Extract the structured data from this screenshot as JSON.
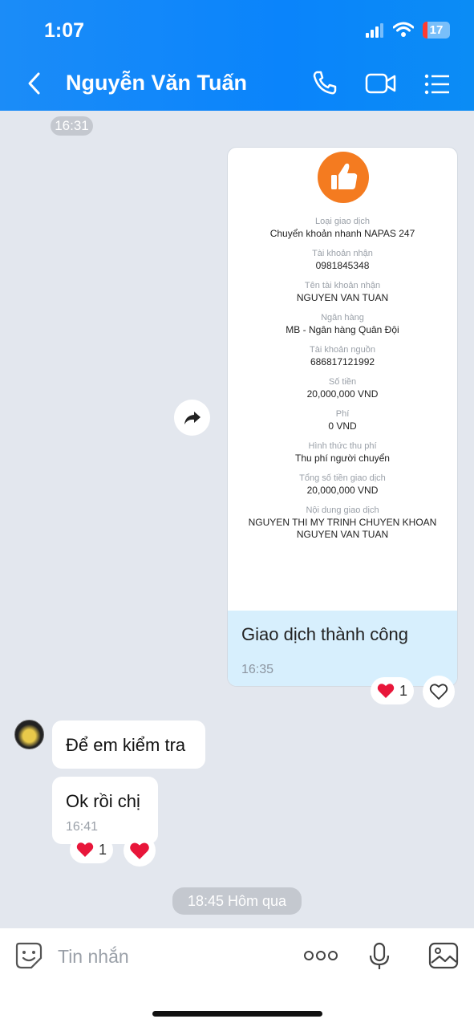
{
  "status_bar": {
    "time": "1:07",
    "battery": "17",
    "battery_level": 0.17
  },
  "header": {
    "contact_name": "Nguyễn Văn Tuấn",
    "icons": [
      "back-chevron-icon",
      "phone-icon",
      "video-call-icon",
      "menu-list-icon"
    ]
  },
  "chat": {
    "time_divider_1": "16:31",
    "transfer_card": {
      "fields": [
        {
          "label": "Loại giao dịch",
          "value": "Chuyển khoản nhanh NAPAS 247"
        },
        {
          "label": "Tài khoản nhận",
          "value": "0981845348"
        },
        {
          "label": "Tên tài khoản nhận",
          "value": "NGUYEN VAN TUAN"
        },
        {
          "label": "Ngân hàng",
          "value": "MB - Ngân hàng Quân Đội"
        },
        {
          "label": "Tài khoản nguồn",
          "value": "686817121992"
        },
        {
          "label": "Số tiền",
          "value": "20,000,000 VND"
        },
        {
          "label": "Phí",
          "value": "0 VND"
        },
        {
          "label": "Hình thức thu phí",
          "value": "Thu phí người chuyển"
        },
        {
          "label": "Tổng số tiền giao dịch",
          "value": "20,000,000 VND"
        },
        {
          "label": "Nội dung giao dịch",
          "value": "NGUYEN THI MY TRINH CHUYEN KHOAN NGUYEN VAN TUAN"
        }
      ],
      "caption": "Giao dịch thành công",
      "time": "16:35",
      "reaction_count": "1"
    },
    "incoming": [
      {
        "text": "Để em kiểm tra"
      },
      {
        "text": "Ok rồi chị",
        "time": "16:41",
        "reaction_count": "1"
      }
    ],
    "time_divider_2": "18:45 Hôm qua"
  },
  "input_bar": {
    "placeholder": "Tin nhắn",
    "icons": [
      "sticker-icon",
      "more-icon",
      "microphone-icon",
      "image-icon"
    ]
  },
  "colors": {
    "header": "#0a84fb",
    "chat_bg": "#e3e7ee",
    "card_caption_bg": "#d7effd",
    "reaction": "#e8163a"
  }
}
